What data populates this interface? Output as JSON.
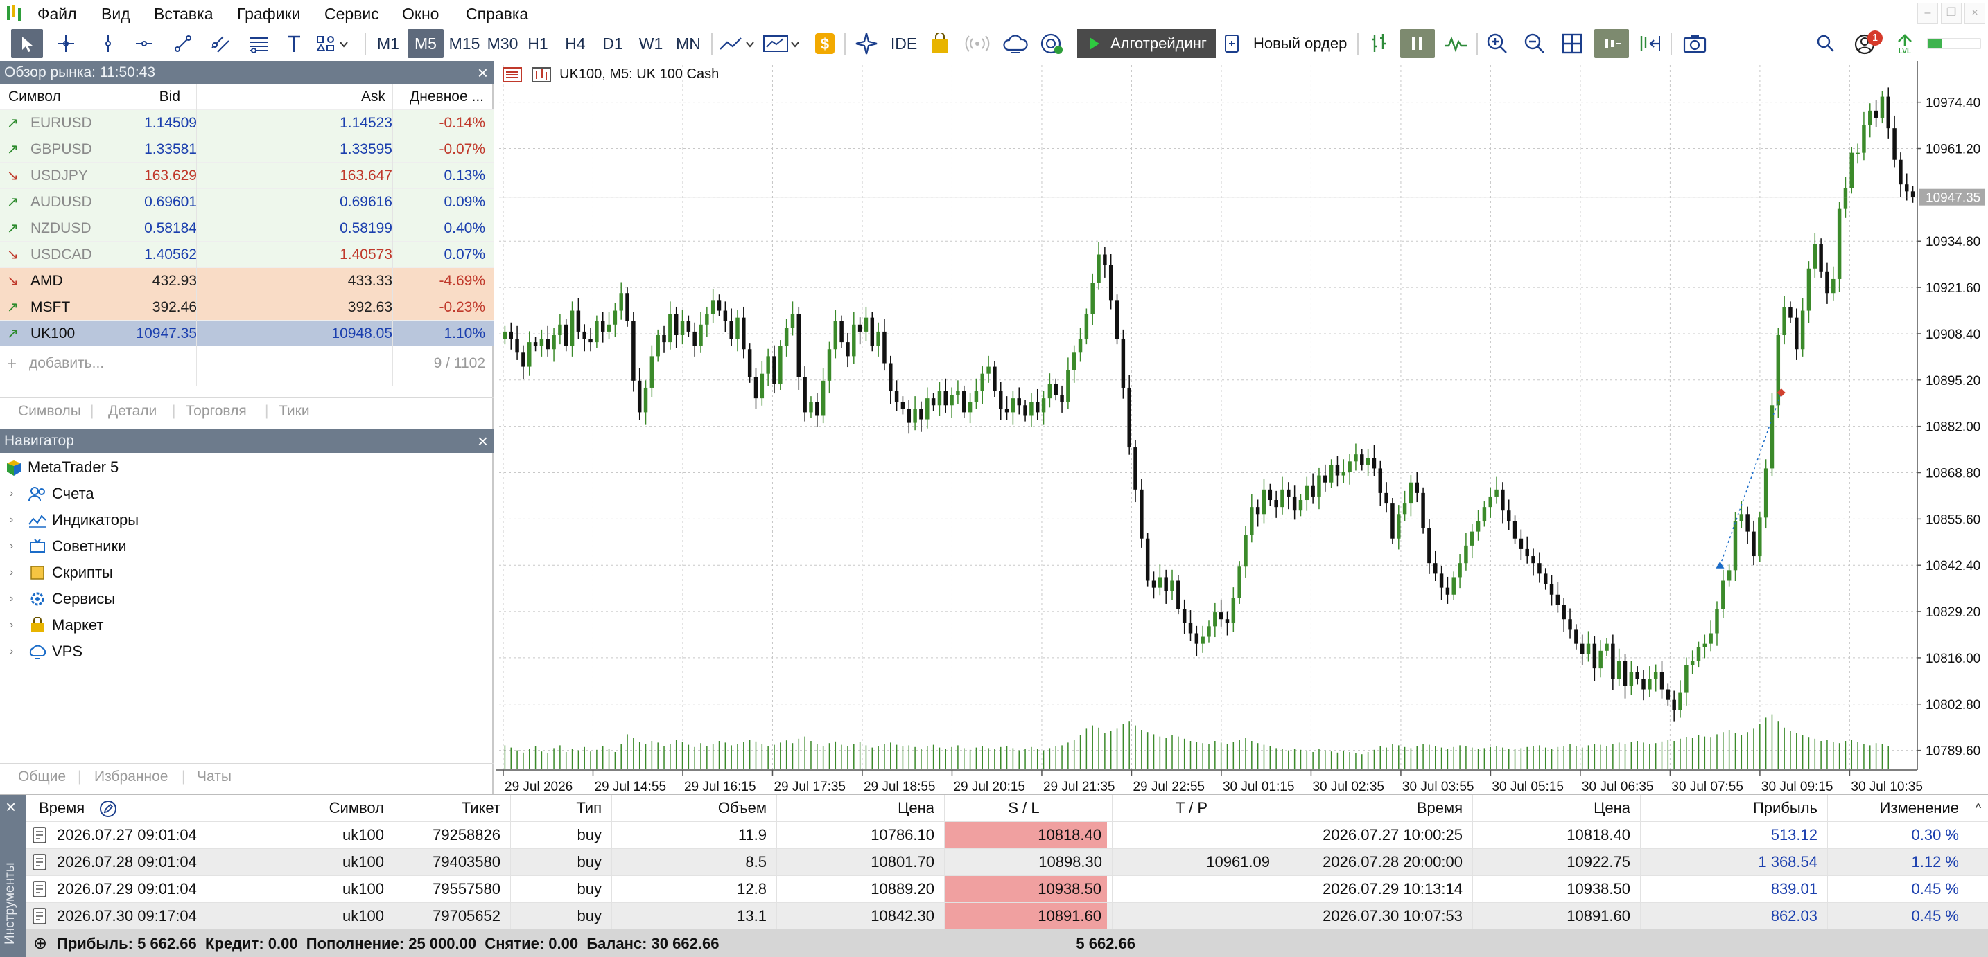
{
  "menu": [
    "Файл",
    "Вид",
    "Вставка",
    "Графики",
    "Сервис",
    "Окно",
    "Справка"
  ],
  "toolbar": {
    "timeframes": [
      "M1",
      "M5",
      "M15",
      "M30",
      "H1",
      "H4",
      "D1",
      "W1",
      "MN"
    ],
    "selected_timeframe": "M5",
    "ide": "IDE",
    "algotrading": "Алготрейдинг",
    "new_order": "Новый ордер",
    "notifications_badge": "1"
  },
  "market_watch": {
    "title": "Обзор рынка: 11:50:43",
    "headers": {
      "symbol": "Символ",
      "bid": "Bid",
      "ask": "Ask",
      "daily": "Дневное ..."
    },
    "rows": [
      {
        "symbol": "EURUSD",
        "bid": "1.14509",
        "ask": "1.14523",
        "change": "-0.14%",
        "dir": "up",
        "group": "fx",
        "bid_color": "#1b3fae",
        "ask_color": "#1b3fae",
        "change_color": "#c0392b",
        "symbol_color": "#8a8a8a",
        "arrow_color": "#2c8a2c"
      },
      {
        "symbol": "GBPUSD",
        "bid": "1.33581",
        "ask": "1.33595",
        "change": "-0.07%",
        "dir": "up",
        "group": "fx",
        "bid_color": "#1b3fae",
        "ask_color": "#1b3fae",
        "change_color": "#c0392b",
        "symbol_color": "#8a8a8a",
        "arrow_color": "#2c8a2c"
      },
      {
        "symbol": "USDJPY",
        "bid": "163.629",
        "ask": "163.647",
        "change": "0.13%",
        "dir": "down",
        "group": "fx",
        "bid_color": "#c0392b",
        "ask_color": "#c0392b",
        "change_color": "#1b3fae",
        "symbol_color": "#8a8a8a",
        "arrow_color": "#c0392b"
      },
      {
        "symbol": "AUDUSD",
        "bid": "0.69601",
        "ask": "0.69616",
        "change": "0.09%",
        "dir": "up",
        "group": "fx",
        "bid_color": "#1b3fae",
        "ask_color": "#1b3fae",
        "change_color": "#1b3fae",
        "symbol_color": "#8a8a8a",
        "arrow_color": "#2c8a2c"
      },
      {
        "symbol": "NZDUSD",
        "bid": "0.58184",
        "ask": "0.58199",
        "change": "0.40%",
        "dir": "up",
        "group": "fx",
        "bid_color": "#1b3fae",
        "ask_color": "#1b3fae",
        "change_color": "#1b3fae",
        "symbol_color": "#8a8a8a",
        "arrow_color": "#2c8a2c"
      },
      {
        "symbol": "USDCAD",
        "bid": "1.40562",
        "ask": "1.40573",
        "change": "0.07%",
        "dir": "down",
        "group": "fx",
        "bid_color": "#1b3fae",
        "ask_color": "#c0392b",
        "change_color": "#1b3fae",
        "symbol_color": "#8a8a8a",
        "arrow_color": "#c0392b"
      },
      {
        "symbol": "AMD",
        "bid": "432.93",
        "ask": "433.33",
        "change": "-4.69%",
        "dir": "down",
        "group": "stock",
        "bid_color": "#222222",
        "ask_color": "#222222",
        "change_color": "#c0392b",
        "symbol_color": "#111111",
        "arrow_color": "#c0392b"
      },
      {
        "symbol": "MSFT",
        "bid": "392.46",
        "ask": "392.63",
        "change": "-0.23%",
        "dir": "up",
        "group": "stock",
        "bid_color": "#222222",
        "ask_color": "#222222",
        "change_color": "#c0392b",
        "symbol_color": "#111111",
        "arrow_color": "#2c8a2c"
      },
      {
        "symbol": "UK100",
        "bid": "10947.35",
        "ask": "10948.05",
        "change": "1.10%",
        "dir": "up",
        "group": "selected",
        "bid_color": "#1b3fae",
        "ask_color": "#1b3fae",
        "change_color": "#1b3fae",
        "symbol_color": "#111111",
        "arrow_color": "#2c8a2c"
      }
    ],
    "add_label": "добавить...",
    "count": "9 / 1102",
    "tabs": [
      "Символы",
      "Детали",
      "Торговля",
      "Тики"
    ]
  },
  "navigator": {
    "title": "Навигатор",
    "root": "MetaTrader 5",
    "items": [
      {
        "label": "Счета",
        "icon": "accounts-icon"
      },
      {
        "label": "Индикаторы",
        "icon": "indicators-icon"
      },
      {
        "label": "Советники",
        "icon": "experts-icon"
      },
      {
        "label": "Скрипты",
        "icon": "scripts-icon"
      },
      {
        "label": "Сервисы",
        "icon": "services-icon"
      },
      {
        "label": "Маркет",
        "icon": "market-icon"
      },
      {
        "label": "VPS",
        "icon": "vps-icon"
      }
    ],
    "tabs": [
      "Общие",
      "Избранное",
      "Чаты"
    ]
  },
  "chart": {
    "header": "UK100, M5:  UK 100 Cash",
    "price_labels": [
      "10974.40",
      "10961.20",
      "10947.35",
      "10934.80",
      "10921.60",
      "10908.40",
      "10895.20",
      "10882.00",
      "10868.80",
      "10855.60",
      "10842.40",
      "10829.20",
      "10816.00",
      "10802.80",
      "10789.60"
    ],
    "time_labels": [
      "29 Jul 2026",
      "29 Jul 14:55",
      "29 Jul 16:15",
      "29 Jul 17:35",
      "29 Jul 18:55",
      "29 Jul 20:15",
      "29 Jul 21:35",
      "29 Jul 22:55",
      "30 Jul 01:15",
      "30 Jul 02:35",
      "30 Jul 03:55",
      "30 Jul 05:15",
      "30 Jul 06:35",
      "30 Jul 07:55",
      "30 Jul 09:15",
      "30 Jul 10:35"
    ]
  },
  "chart_data": {
    "type": "candlestick",
    "title": "UK100, M5:  UK 100 Cash",
    "current_price": 10947.35,
    "ylim": [
      10784,
      10985
    ],
    "bull_color": "#3b8a2a",
    "bear_color": "#111111",
    "closes": [
      10909,
      10907,
      10903,
      10899,
      10906,
      10905,
      10907,
      10904,
      10908,
      10911,
      10905,
      10915,
      10909,
      10907,
      10906,
      10912,
      10909,
      10911,
      10915,
      10920,
      10912,
      10895,
      10886,
      10893,
      10902,
      10908,
      10906,
      10914,
      10908,
      10912,
      10909,
      10905,
      10911,
      10914,
      10918,
      10915,
      10912,
      10907,
      10913,
      10904,
      10896,
      10890,
      10897,
      10902,
      10894,
      10905,
      10910,
      10914,
      10896,
      10886,
      10889,
      10885,
      10895,
      10904,
      10912,
      10906,
      10902,
      10911,
      10909,
      10913,
      10905,
      10909,
      10900,
      10892,
      10889,
      10887,
      10883,
      10887,
      10884,
      10890,
      10888,
      10892,
      10888,
      10891,
      10892,
      10886,
      10889,
      10892,
      10897,
      10899,
      10892,
      10887,
      10886,
      10890,
      10888,
      10885,
      10889,
      10886,
      10890,
      10894,
      10891,
      10889,
      10898,
      10903,
      10907,
      10914,
      10923,
      10931,
      10928,
      10918,
      10907,
      10893,
      10876,
      10864,
      10850,
      10838,
      10836,
      10839,
      10835,
      10838,
      10830,
      10826,
      10823,
      10820,
      10822,
      10825,
      10829,
      10827,
      10826,
      10833,
      10842,
      10851,
      10859,
      10857,
      10864,
      10861,
      10859,
      10864,
      10862,
      10858,
      10861,
      10865,
      10862,
      10868,
      10866,
      10871,
      10868,
      10869,
      10872,
      10874,
      10871,
      10873,
      10870,
      10863,
      10860,
      10850,
      10857,
      10860,
      10866,
      10863,
      10853,
      10843,
      10840,
      10836,
      10834,
      10839,
      10843,
      10848,
      10852,
      10855,
      10859,
      10862,
      10864,
      10858,
      10855,
      10850,
      10847,
      10845,
      10843,
      10840,
      10837,
      10834,
      10831,
      10827,
      10824,
      10820,
      10817,
      10820,
      10813,
      10818,
      10820,
      10810,
      10815,
      10808,
      10812,
      10810,
      10807,
      10810,
      10812,
      10807,
      10804,
      10801,
      10806,
      10814,
      10815,
      10819,
      10820,
      10823,
      10830,
      10838,
      10841,
      10855,
      10857,
      10852,
      10845,
      10856,
      10870,
      10888,
      10908,
      10916,
      10913,
      10904,
      10915,
      10927,
      10934,
      10926,
      10920,
      10924,
      10944,
      10950,
      10960,
      10960,
      10968,
      10972,
      10970,
      10976,
      10967,
      10958,
      10951,
      10949,
      10947.35
    ],
    "volumes": [
      0.42,
      0.38,
      0.33,
      0.29,
      0.35,
      0.4,
      0.31,
      0.28,
      0.37,
      0.42,
      0.3,
      0.36,
      0.33,
      0.39,
      0.31,
      0.34,
      0.41,
      0.36,
      0.3,
      0.45,
      0.62,
      0.55,
      0.48,
      0.44,
      0.5,
      0.47,
      0.4,
      0.45,
      0.52,
      0.48,
      0.43,
      0.39,
      0.46,
      0.41,
      0.44,
      0.5,
      0.47,
      0.42,
      0.44,
      0.48,
      0.52,
      0.49,
      0.45,
      0.41,
      0.43,
      0.47,
      0.51,
      0.46,
      0.54,
      0.58,
      0.5,
      0.44,
      0.41,
      0.46,
      0.49,
      0.43,
      0.4,
      0.45,
      0.48,
      0.42,
      0.38,
      0.41,
      0.44,
      0.47,
      0.43,
      0.4,
      0.42,
      0.39,
      0.36,
      0.4,
      0.43,
      0.38,
      0.35,
      0.39,
      0.42,
      0.37,
      0.34,
      0.38,
      0.41,
      0.37,
      0.35,
      0.39,
      0.41,
      0.37,
      0.33,
      0.36,
      0.39,
      0.35,
      0.33,
      0.37,
      0.4,
      0.42,
      0.47,
      0.52,
      0.6,
      0.72,
      0.78,
      0.74,
      0.65,
      0.68,
      0.72,
      0.8,
      0.86,
      0.78,
      0.7,
      0.66,
      0.62,
      0.58,
      0.55,
      0.61,
      0.58,
      0.54,
      0.5,
      0.48,
      0.46,
      0.45,
      0.5,
      0.47,
      0.44,
      0.48,
      0.52,
      0.55,
      0.5,
      0.46,
      0.43,
      0.4,
      0.37,
      0.35,
      0.33,
      0.36,
      0.34,
      0.32,
      0.3,
      0.35,
      0.33,
      0.31,
      0.29,
      0.32,
      0.3,
      0.28,
      0.26,
      0.3,
      0.34,
      0.4,
      0.38,
      0.44,
      0.42,
      0.39,
      0.37,
      0.41,
      0.45,
      0.43,
      0.4,
      0.38,
      0.36,
      0.39,
      0.42,
      0.4,
      0.38,
      0.35,
      0.37,
      0.39,
      0.41,
      0.38,
      0.36,
      0.35,
      0.37,
      0.39,
      0.4,
      0.42,
      0.38,
      0.36,
      0.39,
      0.41,
      0.44,
      0.4,
      0.38,
      0.42,
      0.45,
      0.43,
      0.41,
      0.44,
      0.47,
      0.45,
      0.48,
      0.5,
      0.47,
      0.44,
      0.46,
      0.49,
      0.52,
      0.5,
      0.54,
      0.57,
      0.55,
      0.6,
      0.58,
      0.56,
      0.62,
      0.66,
      0.7,
      0.64,
      0.6,
      0.66,
      0.72,
      0.8,
      0.92,
      0.98,
      0.86,
      0.74,
      0.68,
      0.64,
      0.6,
      0.56,
      0.54,
      0.5,
      0.52,
      0.48,
      0.46,
      0.5,
      0.52,
      0.48,
      0.45,
      0.42,
      0.46,
      0.44,
      0.4
    ],
    "trade_markers": [
      {
        "type": "buy",
        "price": 10842.3
      },
      {
        "type": "exit",
        "price": 10891.6
      }
    ]
  },
  "trade_table": {
    "headers": [
      "Время",
      "Символ",
      "Тикет",
      "Тип",
      "Объем",
      "Цена",
      "S / L",
      "T / P",
      "Время",
      "Цена",
      "Прибыль",
      "Изменение"
    ],
    "rows": [
      {
        "open_time": "2026.07.27 09:01:04",
        "symbol": "uk100",
        "ticket": "79258826",
        "type": "buy",
        "volume": "11.9",
        "open_price": "10786.10",
        "sl": "10818.40",
        "tp": "",
        "close_time": "2026.07.27 10:00:25",
        "close_price": "10818.40",
        "profit": "513.12",
        "change": "0.30 %",
        "sl_hit": true
      },
      {
        "open_time": "2026.07.28 09:01:04",
        "symbol": "uk100",
        "ticket": "79403580",
        "type": "buy",
        "volume": "8.5",
        "open_price": "10801.70",
        "sl": "10898.30",
        "tp": "10961.09",
        "close_time": "2026.07.28 20:00:00",
        "close_price": "10922.75",
        "profit": "1 368.54",
        "change": "1.12 %",
        "sl_hit": false
      },
      {
        "open_time": "2026.07.29 09:01:04",
        "symbol": "uk100",
        "ticket": "79557580",
        "type": "buy",
        "volume": "12.8",
        "open_price": "10889.20",
        "sl": "10938.50",
        "tp": "",
        "close_time": "2026.07.29 10:13:14",
        "close_price": "10938.50",
        "profit": "839.01",
        "change": "0.45 %",
        "sl_hit": true
      },
      {
        "open_time": "2026.07.30 09:17:04",
        "symbol": "uk100",
        "ticket": "79705652",
        "type": "buy",
        "volume": "13.1",
        "open_price": "10842.30",
        "sl": "10891.60",
        "tp": "",
        "close_time": "2026.07.30 10:07:53",
        "close_price": "10891.60",
        "profit": "862.03",
        "change": "0.45 %",
        "sl_hit": true
      }
    ],
    "summary": "Прибыль: 5 662.66  Кредит: 0.00  Пополнение: 25 000.00  Снятие: 0.00  Баланс: 30 662.66",
    "summary_total": "5 662.66",
    "side_label": "Инструменты",
    "sl_hit_color": "#f0a0a0"
  }
}
